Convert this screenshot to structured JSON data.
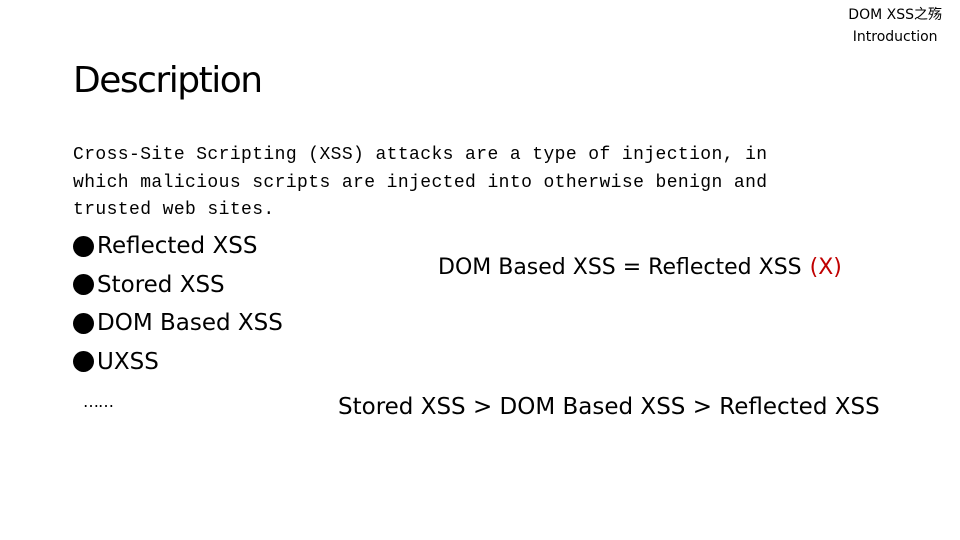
{
  "header": {
    "line1": "DOM XSS之殇",
    "line2": "Introduction"
  },
  "title": "Description",
  "description": "Cross-Site Scripting (XSS) attacks are a type of injection, in\nwhich malicious scripts are injected into otherwise benign and\ntrusted web sites.",
  "bullets": [
    "Reflected XSS",
    "Stored XSS",
    "DOM Based XSS",
    "UXSS"
  ],
  "ellipsis": "……",
  "equation": {
    "text": "DOM Based XSS = Reflected XSS",
    "mark": "(X)",
    "mark_color": "#c00000"
  },
  "comparison": "Stored XSS > DOM Based XSS > Reflected XSS"
}
